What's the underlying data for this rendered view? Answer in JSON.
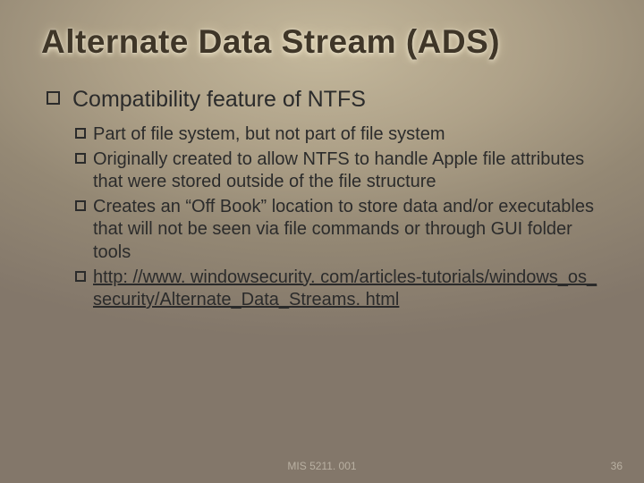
{
  "title": "Alternate Data Stream (ADS)",
  "lvl1": {
    "text": "Compatibility feature of NTFS"
  },
  "lvl2": {
    "items": [
      "Part of file system, but not part of file system",
      "Originally created to allow NTFS to handle Apple file attributes that were stored outside of the file structure",
      "Creates an “Off Book” location to store data and/or executables that will not be seen via file commands or through GUI folder tools"
    ],
    "link": "http: //www. windowsecurity. com/articles-tutorials/windows_os_security/Alternate_Data_Streams. html"
  },
  "footer": {
    "course": "MIS 5211. 001",
    "page": "36"
  }
}
